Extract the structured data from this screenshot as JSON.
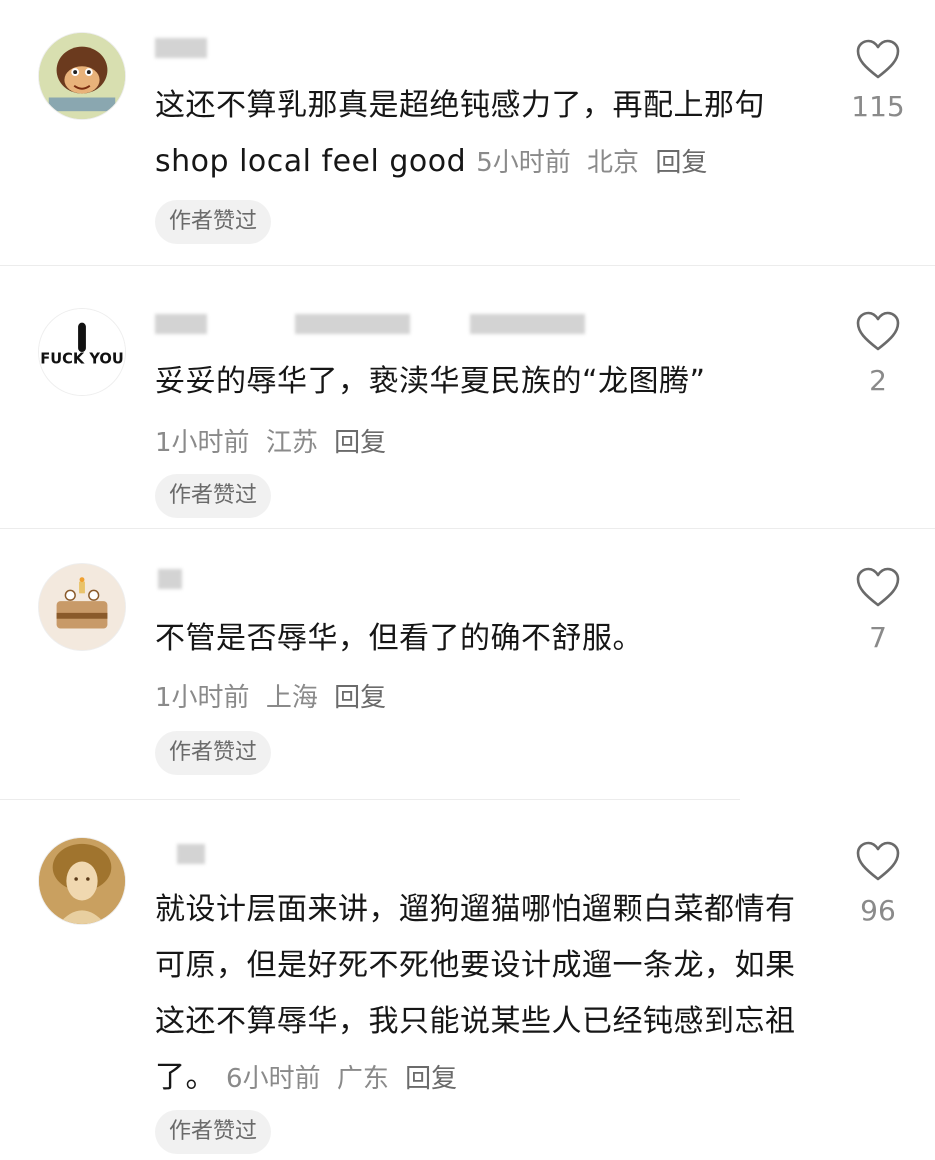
{
  "comments": [
    {
      "text": "这还不算乳那真是超绝钝感力了，再配上那句 shop local feel good",
      "time": "5小时前",
      "location": "北京",
      "reply_label": "回复",
      "author_badge": "作者赞过",
      "likes": "115"
    },
    {
      "text": "妥妥的辱华了，亵渎华夏民族的“龙图腾”",
      "time": "1小时前",
      "location": "江苏",
      "reply_label": "回复",
      "author_badge": "作者赞过",
      "likes": "2",
      "avatar_text": "FUCK YOU"
    },
    {
      "text": "不管是否辱华，但看了的确不舒服。",
      "time": "1小时前",
      "location": "上海",
      "reply_label": "回复",
      "author_badge": "作者赞过",
      "likes": "7"
    },
    {
      "text": "就设计层面来讲，遛狗遛猫哪怕遛颗白菜都情有可原，但是好死不死他要设计成遛一条龙，如果这还不算辱华，我只能说某些人已经钝感到忘祖了。",
      "time": "6小时前",
      "location": "广东",
      "reply_label": "回复",
      "author_badge": "作者赞过",
      "likes": "96"
    }
  ],
  "icons": {
    "like": "heart-outline-icon"
  },
  "colors": {
    "text": "#161616",
    "meta": "#8a8a8a",
    "badge_bg": "#f1f1f1"
  }
}
